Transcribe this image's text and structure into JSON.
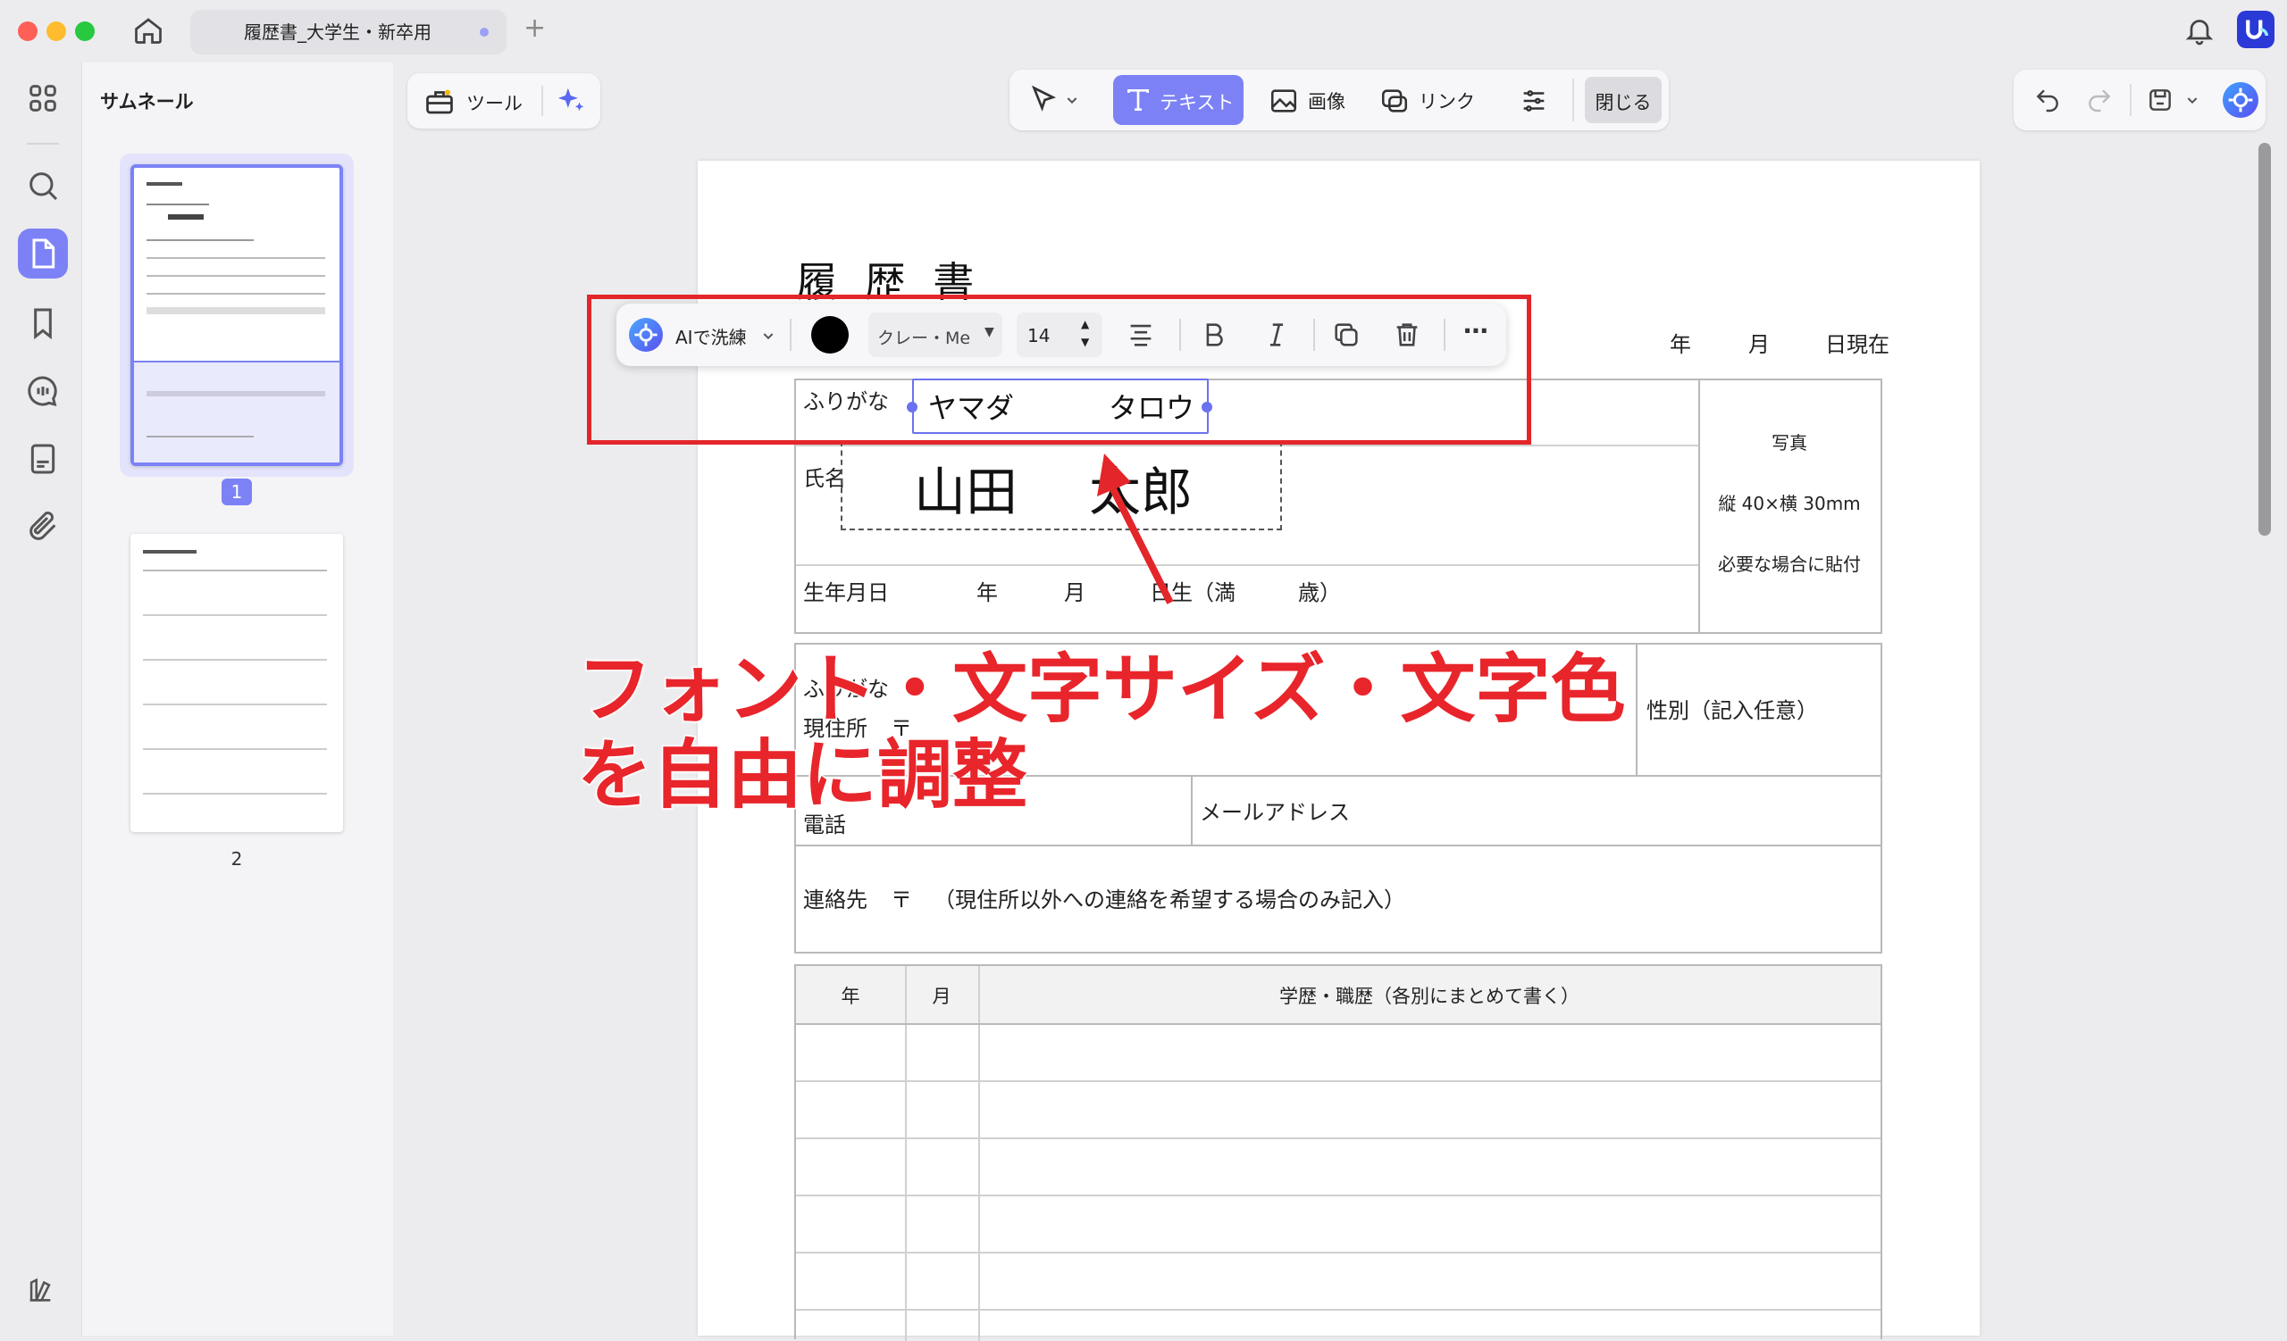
{
  "window": {
    "tab_title": "履歴書_大学生・新卒用"
  },
  "sidebar": {
    "icons": [
      "grid-icon",
      "search-icon",
      "page-icon",
      "bookmark-icon",
      "comment-icon",
      "document-icon",
      "attachment-icon"
    ],
    "bottom_icon": "sidebar-toggle-icon"
  },
  "thumbnails": {
    "title": "サムネール",
    "pages": [
      {
        "number": "1",
        "selected": true
      },
      {
        "number": "2",
        "selected": false
      }
    ]
  },
  "toolbar": {
    "tools_label": "ツール",
    "text_label": "テキスト",
    "image_label": "画像",
    "link_label": "リンク",
    "close_label": "閉じる"
  },
  "format_bar": {
    "ai_label": "AIで洗練",
    "font_color": "#000000",
    "font_name": "クレー・Me",
    "font_size": "14"
  },
  "resume": {
    "title": "履 歴 書",
    "date_year": "年",
    "date_month": "月",
    "date_suffix": "日現在",
    "furigana_label": "ふりがな",
    "furigana_value_family": "ヤマダ",
    "furigana_value_given": "タロウ",
    "name_label": "氏名",
    "name_value_family": "山田",
    "name_value_given": "太郎",
    "birth_label": "生年月日",
    "birth_year": "年",
    "birth_month": "月",
    "birth_day": "日生（満",
    "birth_age": "歳）",
    "photo_line1": "写真",
    "photo_line2": "縦 40×横 30mm",
    "photo_line3": "必要な場合に貼付",
    "addr_furigana": "ふりがな",
    "address_label": "現住所",
    "postal_mark": "〒",
    "gender_label": "性別（記入任意）",
    "phone_label": "電話",
    "email_label": "メールアドレス",
    "contact_label": "連絡先",
    "contact_note": "（現住所以外への連絡を希望する場合のみ記入）",
    "history_col_year": "年",
    "history_col_month": "月",
    "history_col_content": "学歴・職歴（各別にまとめて書く）"
  },
  "annotation": {
    "line1": "フォント・文字サイズ・文字色",
    "line2": "を自由に調整",
    "color": "#e8252b"
  }
}
